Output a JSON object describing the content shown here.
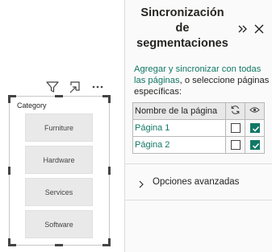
{
  "pane": {
    "title_line1": "Sincronización",
    "title_line2": "de",
    "title_line3": "segmentaciones",
    "description_link": "Agregar y sincronizar con todas las páginas",
    "description_rest": ", o seleccione páginas específicas:",
    "table": {
      "header_page": "Nombre de la página",
      "sync_icon": "sync-icon",
      "visible_icon": "eye-icon",
      "rows": [
        {
          "page": "Página 1",
          "sync": false,
          "visible": true
        },
        {
          "page": "Página 2",
          "sync": false,
          "visible": true
        }
      ]
    },
    "advanced_label": "Opciones avanzadas",
    "accent_color": "#117865"
  },
  "slicer": {
    "title": "Category",
    "items": [
      "Furniture",
      "Hardware",
      "Services",
      "Software"
    ]
  }
}
